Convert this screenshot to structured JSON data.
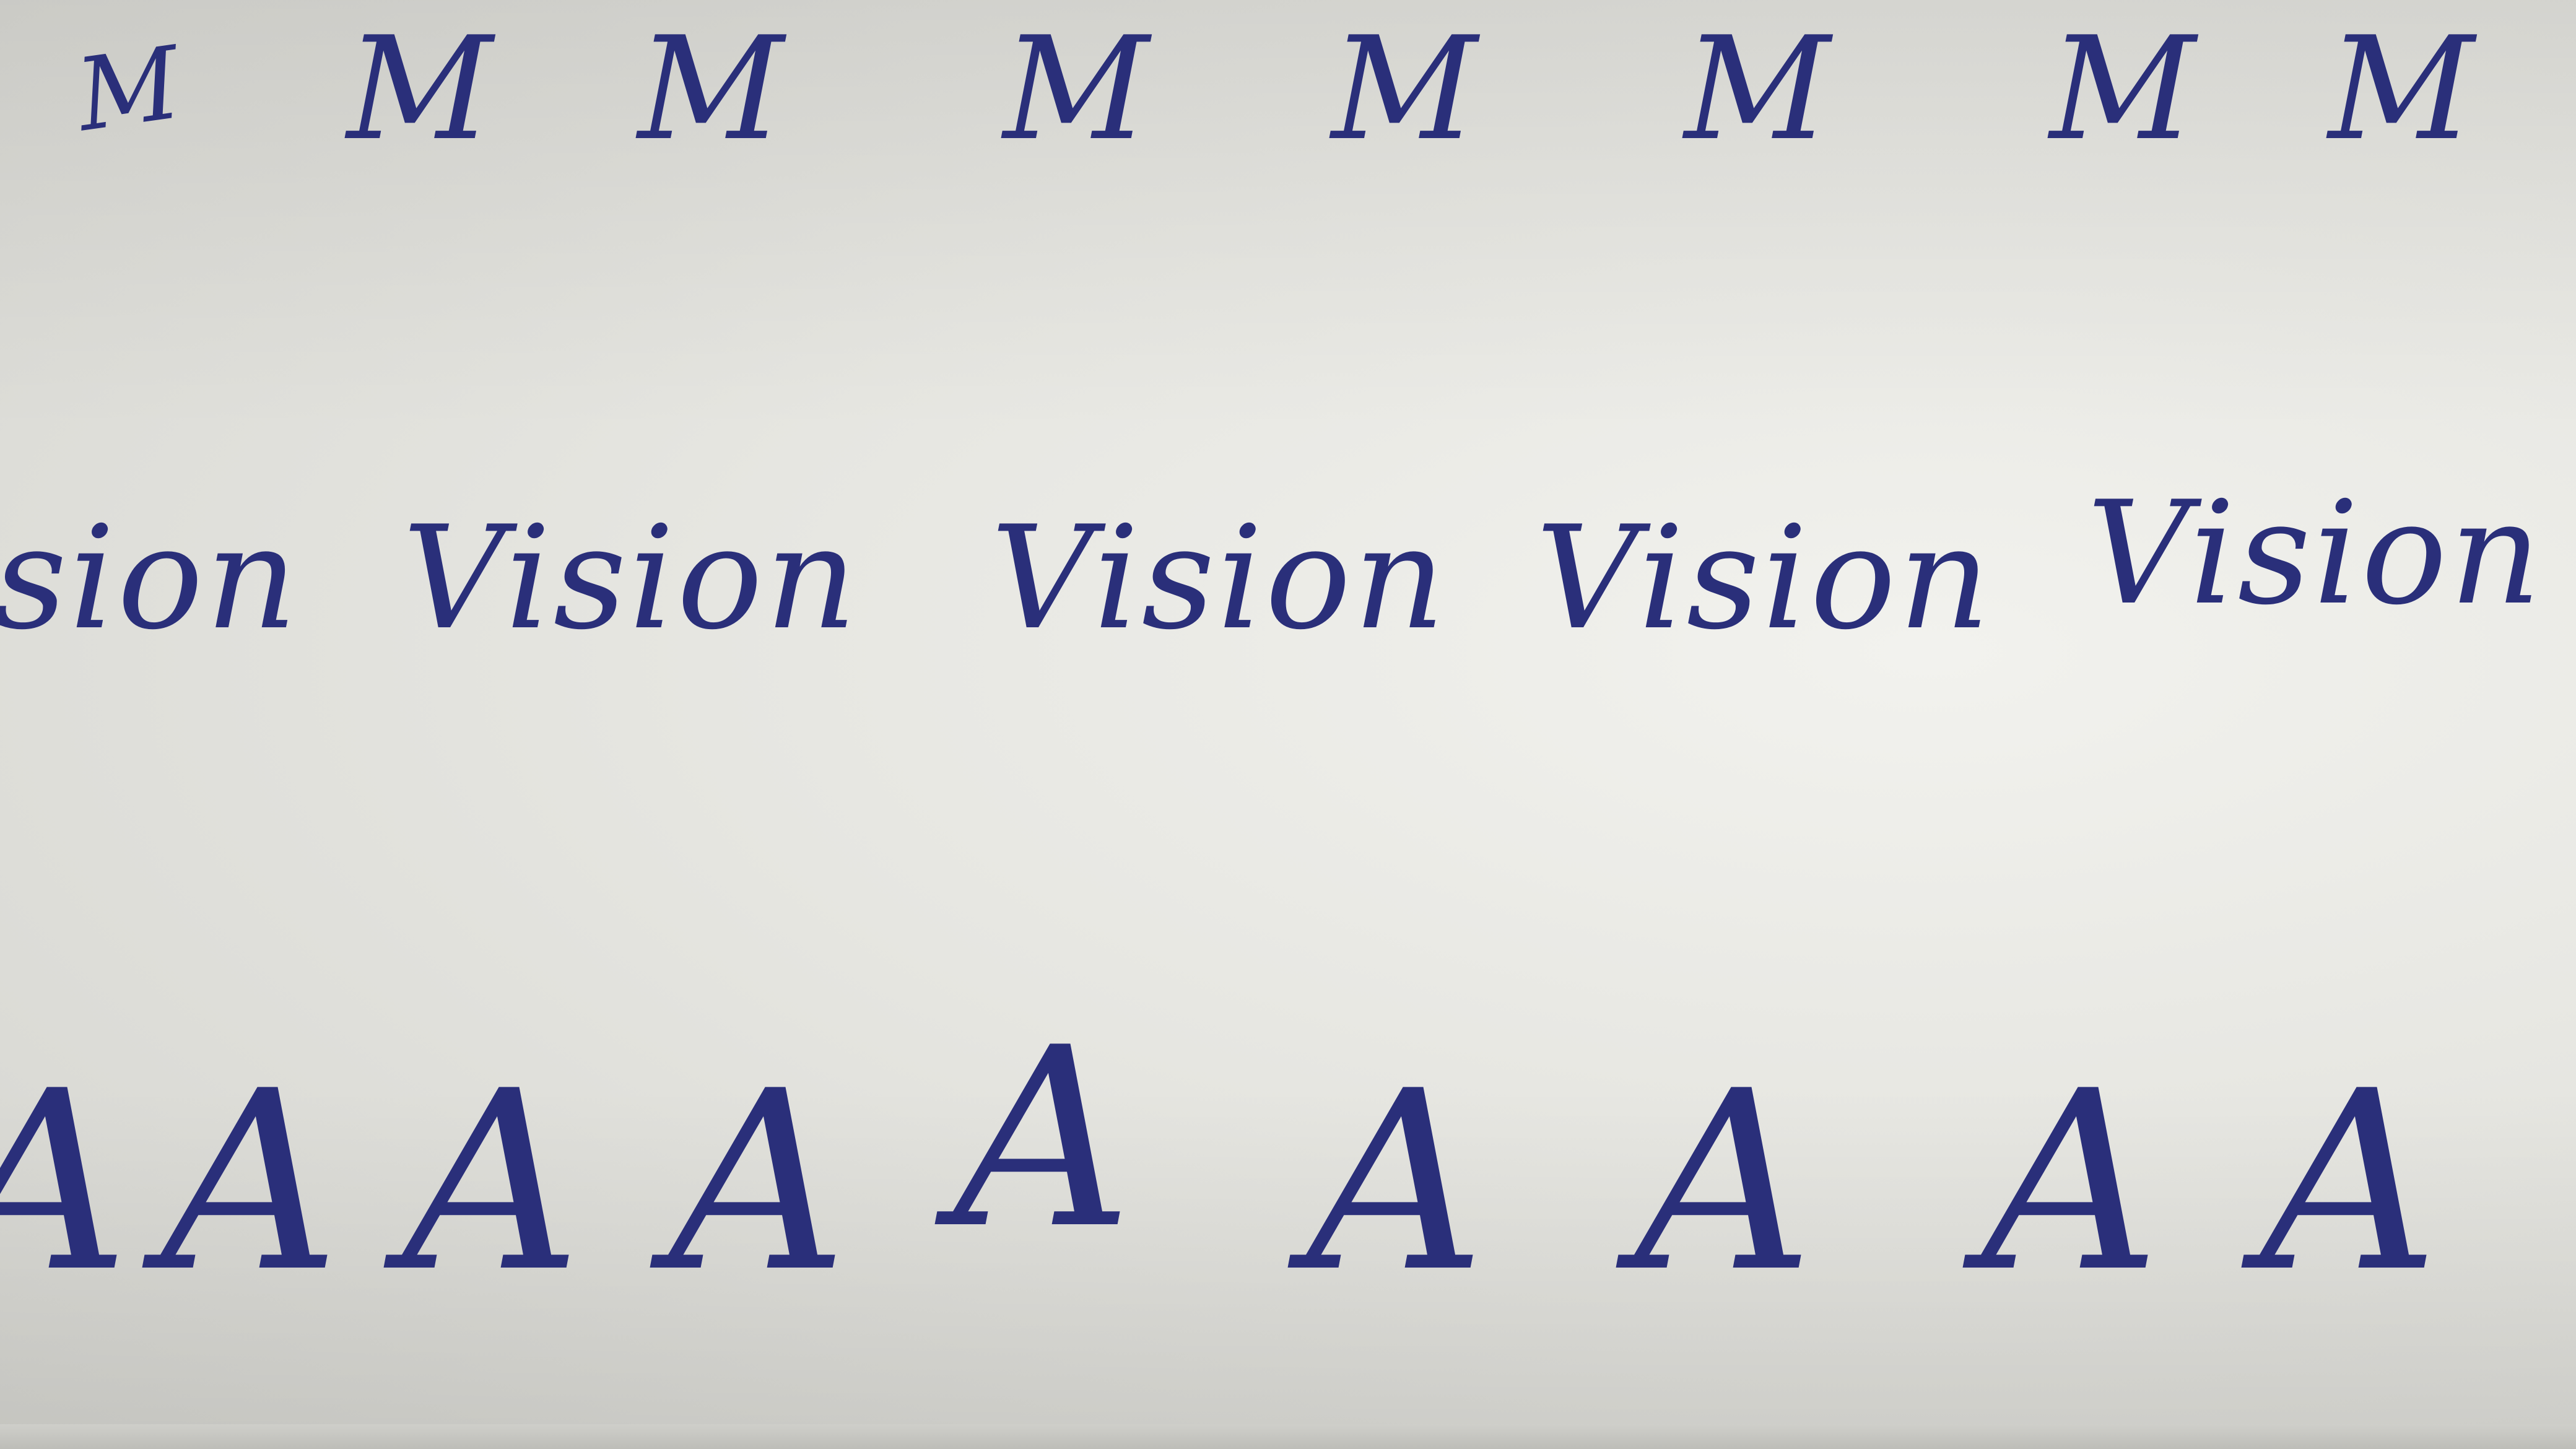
{
  "image": {
    "background_color": "#e9e9e4",
    "ink_color": "#2a2f7a"
  },
  "rows": {
    "m": [
      "M",
      "M",
      "M",
      "M",
      "M",
      "M",
      "M",
      "M"
    ],
    "vision": [
      "sion",
      "Vision",
      "Vision",
      "Vision",
      "Vision"
    ],
    "a": [
      "A",
      "A",
      "A",
      "A",
      "A",
      "A",
      "A",
      "A",
      "A"
    ]
  }
}
